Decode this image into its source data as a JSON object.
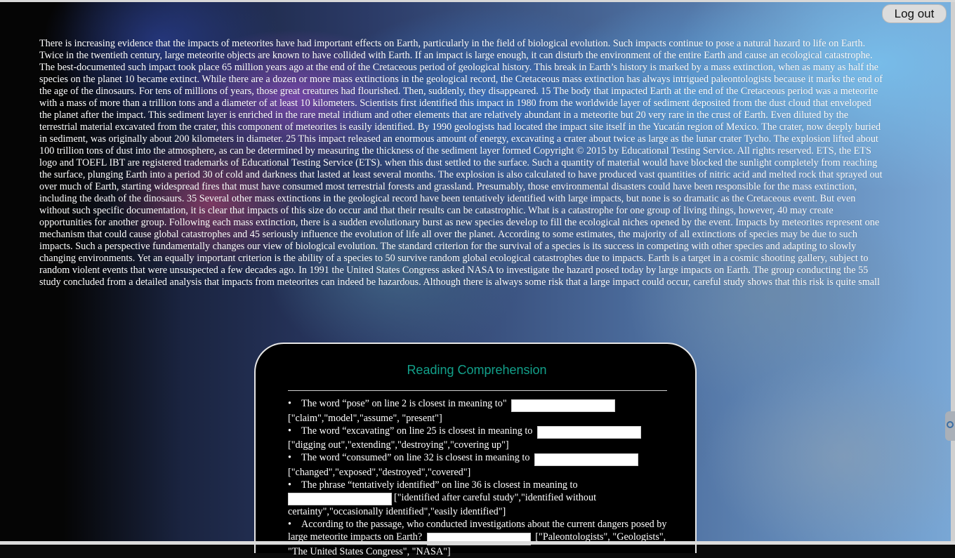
{
  "header": {
    "logout_label": "Log out"
  },
  "passage": {
    "text": "There is increasing evidence that the impacts of meteorites have had important effects on Earth, particularly in the field of biological evolution. Such impacts continue to pose a natural hazard to life on Earth. Twice in the twentieth century, large meteorite objects are known to have collided with Earth. If an impact is large enough, it can disturb the environment of the entire Earth and cause an ecological catastrophe. The best-documented such impact took place 65 million years ago at the end of the Cretaceous period of geological history. This break in Earth’s history is marked by a mass extinction, when as many as half the species on the planet 10 became extinct. While there are a dozen or more mass extinctions in the geological record, the Cretaceous mass extinction has always intrigued paleontologists because it marks the end of the age of the dinosaurs. For tens of millions of years, those great creatures had flourished. Then, suddenly, they disappeared. 15 The body that impacted Earth at the end of the Cretaceous period was a meteorite with a mass of more than a trillion tons and a diameter of at least 10 kilometers. Scientists first identified this impact in 1980 from the worldwide layer of sediment deposited from the dust cloud that enveloped the planet after the impact. This sediment layer is enriched in the rare metal iridium and other elements that are relatively abundant in a meteorite but 20 very rare in the crust of Earth. Even diluted by the terrestrial material excavated from the crater, this component of meteorites is easily identified. By 1990 geologists had located the impact site itself in the Yucatán region of Mexico. The crater, now deeply buried in sediment, was originally about 200 kilometers in diameter. 25 This impact released an enormous amount of energy, excavating a crater about twice as large as the lunar crater Tycho. The explosion lifted about 100 trillion tons of dust into the atmosphere, as can be determined by measuring the thickness of the sediment layer formed Copyright © 2015 by Educational Testing Service. All rights reserved. ETS, the ETS logo and TOEFL IBT are registered trademarks of Educational Testing Service (ETS). when this dust settled to the surface. Such a quantity of material would have blocked the sunlight completely from reaching the surface, plunging Earth into a period 30 of cold and darkness that lasted at least several months. The explosion is also calculated to have produced vast quantities of nitric acid and melted rock that sprayed out over much of Earth, starting widespread fires that must have consumed most terrestrial forests and grassland. Presumably, those environmental disasters could have been responsible for the mass extinction, including the death of the dinosaurs. 35 Several other mass extinctions in the geological record have been tentatively identified with large impacts, but none is so dramatic as the Cretaceous event. But even without such specific documentation, it is clear that impacts of this size do occur and that their results can be catastrophic. What is a catastrophe for one group of living things, however, 40 may create opportunities for another group. Following each mass extinction, there is a sudden evolutionary burst as new species develop to fill the ecological niches opened by the event. Impacts by meteorites represent one mechanism that could cause global catastrophes and 45 seriously influence the evolution of life all over the planet. According to some estimates, the majority of all extinctions of species may be due to such impacts. Such a perspective fundamentally changes our view of biological evolution. The standard criterion for the survival of a species is its success in competing with other species and adapting to slowly changing environments. Yet an equally important criterion is the ability of a species to 50 survive random global ecological catastrophes due to impacts. Earth is a target in a cosmic shooting gallery, subject to random violent events that were unsuspected a few decades ago. In 1991 the United States Congress asked NASA to investigate the hazard posed today by large impacts on Earth. The group conducting the 55 study concluded from a detailed analysis that impacts from meteorites can indeed be hazardous. Although there is always some risk that a large impact could occur, careful study shows that this risk is quite small"
  },
  "quiz": {
    "title": "Reading Comprehension",
    "bullet": "•",
    "questions": [
      {
        "prompt": "The word “pose” on line 2 is closest in meaning to\"",
        "options": "[\"claim\",\"model\",\"assume\", \"present\"]",
        "answer": ""
      },
      {
        "prompt": "The word “excavating” on line 25 is closest in meaning to",
        "options": "[\"digging out\",\"extending\",\"destroying\",\"covering up\"]",
        "answer": ""
      },
      {
        "prompt": "The word “consumed” on line 32 is closest in meaning to",
        "options": "[\"changed\",\"exposed\",\"destroyed\",\"covered\"]",
        "answer": ""
      },
      {
        "prompt": "The phrase “tentatively identified” on line 36 is closest in meaning to",
        "options": "[\"identified after careful study\",\"identified without certainty\",\"occasionally identified\",\"easily identified\"]",
        "answer": ""
      },
      {
        "prompt": "According to the passage, who conducted investigations about the current dangers posed by large meteorite impacts on Earth?",
        "options": "[\"Paleontologists\", \"Geologists\", \"The United States Congress\", \"NASA\"]",
        "answer": ""
      }
    ]
  }
}
